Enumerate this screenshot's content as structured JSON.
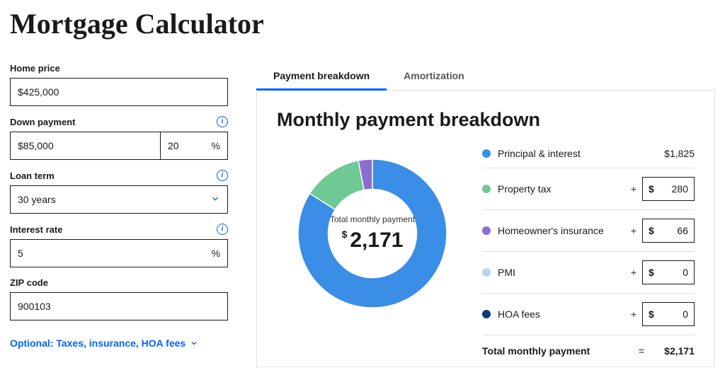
{
  "title": "Mortgage Calculator",
  "form": {
    "home_price_label": "Home price",
    "home_price_value": "$425,000",
    "down_payment_label": "Down payment",
    "down_payment_value": "$85,000",
    "down_payment_pct": "20",
    "pct_symbol": "%",
    "loan_term_label": "Loan term",
    "loan_term_value": "30 years",
    "interest_rate_label": "Interest rate",
    "interest_rate_value": "5",
    "zip_label": "ZIP code",
    "zip_value": "900103",
    "optional_link": "Optional: Taxes, insurance, HOA fees"
  },
  "tabs": {
    "breakdown": "Payment breakdown",
    "amortization": "Amortization"
  },
  "panel": {
    "heading": "Monthly payment breakdown",
    "center_label": "Total monthly payment",
    "center_symbol": "$",
    "center_value": "2,171"
  },
  "items": {
    "pi_label": "Principal & interest",
    "pi_value": "$1,825",
    "tax_label": "Property tax",
    "tax_value": "280",
    "ins_label": "Homeowner's insurance",
    "ins_value": "66",
    "pmi_label": "PMI",
    "pmi_value": "0",
    "hoa_label": "HOA fees",
    "hoa_value": "0",
    "dollar": "$",
    "plus": "+",
    "total_label": "Total monthly payment",
    "equals": "=",
    "total_value": "$2,171"
  },
  "colors": {
    "pi": "#3a8ee6",
    "tax": "#6ec994",
    "ins": "#8a6fd1",
    "pmi": "#b5d6f0",
    "hoa": "#093a7a"
  },
  "chart_data": {
    "type": "pie",
    "title": "Monthly payment breakdown",
    "series": [
      {
        "name": "Principal & interest",
        "value": 1825,
        "color": "#3a8ee6"
      },
      {
        "name": "Property tax",
        "value": 280,
        "color": "#6ec994"
      },
      {
        "name": "Homeowner's insurance",
        "value": 66,
        "color": "#8a6fd1"
      },
      {
        "name": "PMI",
        "value": 0,
        "color": "#b5d6f0"
      },
      {
        "name": "HOA fees",
        "value": 0,
        "color": "#093a7a"
      }
    ],
    "total": 2171,
    "center_label": "Total monthly payment"
  }
}
